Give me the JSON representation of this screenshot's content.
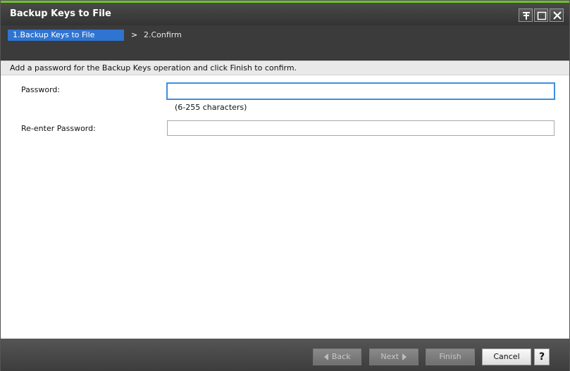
{
  "window": {
    "title": "Backup Keys to File",
    "controls": [
      "pin-icon",
      "maximize-icon",
      "close-icon"
    ]
  },
  "steps": {
    "active": "1.Backup Keys to File",
    "separator": ">",
    "next": "2.Confirm"
  },
  "instruction": "Add a password for the Backup Keys operation and click Finish to confirm.",
  "form": {
    "password_label": "Password:",
    "password_value": "",
    "password_hint": "(6-255 characters)",
    "reenter_label": "Re-enter Password:",
    "reenter_value": ""
  },
  "footer": {
    "back_label": "Back",
    "next_label": "Next",
    "finish_label": "Finish",
    "cancel_label": "Cancel",
    "help_label": "?"
  },
  "colors": {
    "accent_green": "#6cc32a",
    "active_step": "#2f74d0",
    "focus_border": "#3b8fe0"
  }
}
